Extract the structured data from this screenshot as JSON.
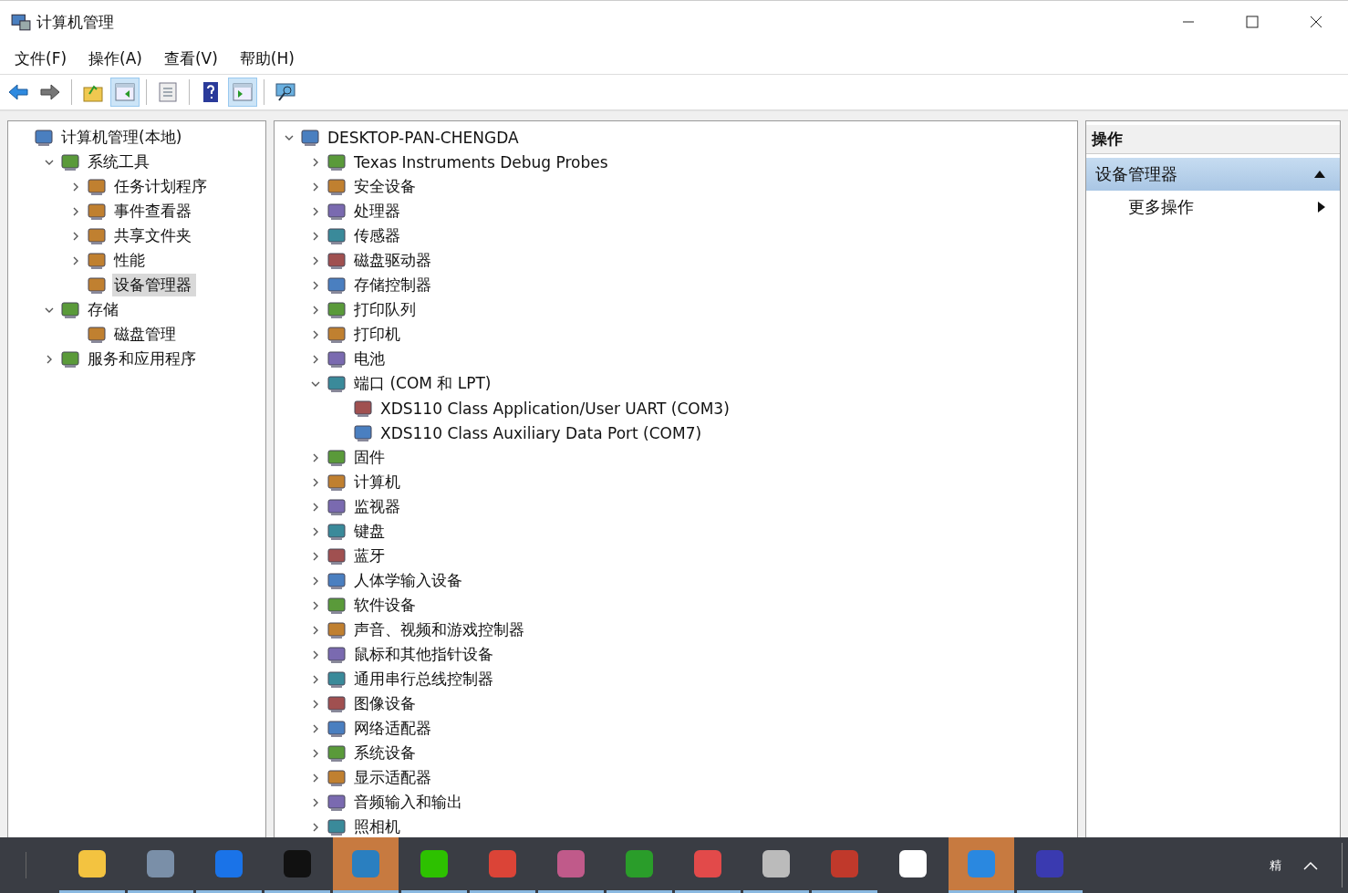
{
  "window": {
    "title": "计算机管理"
  },
  "menu": [
    "文件(F)",
    "操作(A)",
    "查看(V)",
    "帮助(H)"
  ],
  "toolbar": [
    {
      "kind": "back",
      "pressed": false
    },
    {
      "kind": "forward",
      "pressed": false
    },
    {
      "kind": "sep"
    },
    {
      "kind": "up",
      "pressed": false
    },
    {
      "kind": "pane-left",
      "pressed": true
    },
    {
      "kind": "sep"
    },
    {
      "kind": "properties",
      "pressed": false
    },
    {
      "kind": "sep"
    },
    {
      "kind": "help",
      "pressed": false
    },
    {
      "kind": "pane-right",
      "pressed": true
    },
    {
      "kind": "sep"
    },
    {
      "kind": "monitor",
      "pressed": false
    }
  ],
  "nav_tree": [
    {
      "label": "计算机管理(本地)",
      "selected": false,
      "children": [
        {
          "label": "系统工具",
          "expanded": true,
          "selected": false,
          "children": [
            {
              "label": "任务计划程序",
              "expanded": false,
              "selected": false
            },
            {
              "label": "事件查看器",
              "expanded": false,
              "selected": false
            },
            {
              "label": "共享文件夹",
              "expanded": false,
              "selected": false
            },
            {
              "label": "性能",
              "expanded": false,
              "selected": false
            },
            {
              "label": "设备管理器",
              "selected": true
            }
          ]
        },
        {
          "label": "存储",
          "expanded": true,
          "selected": false,
          "children": [
            {
              "label": "磁盘管理",
              "selected": false
            }
          ]
        },
        {
          "label": "服务和应用程序",
          "expanded": false,
          "selected": false
        }
      ]
    }
  ],
  "device_tree": [
    {
      "label": "DESKTOP-PAN-CHENGDA",
      "expanded": true,
      "children": [
        {
          "label": "Texas Instruments Debug Probes",
          "expanded": false
        },
        {
          "label": "安全设备",
          "expanded": false
        },
        {
          "label": "处理器",
          "expanded": false
        },
        {
          "label": "传感器",
          "expanded": false
        },
        {
          "label": "磁盘驱动器",
          "expanded": false
        },
        {
          "label": "存储控制器",
          "expanded": false
        },
        {
          "label": "打印队列",
          "expanded": false
        },
        {
          "label": "打印机",
          "expanded": false
        },
        {
          "label": "电池",
          "expanded": false
        },
        {
          "label": "端口 (COM 和 LPT)",
          "expanded": true,
          "children": [
            {
              "label": "XDS110 Class Application/User UART (COM3)"
            },
            {
              "label": "XDS110 Class Auxiliary Data Port (COM7)"
            }
          ]
        },
        {
          "label": "固件",
          "expanded": false
        },
        {
          "label": "计算机",
          "expanded": false
        },
        {
          "label": "监视器",
          "expanded": false
        },
        {
          "label": "键盘",
          "expanded": false
        },
        {
          "label": "蓝牙",
          "expanded": false
        },
        {
          "label": "人体学输入设备",
          "expanded": false
        },
        {
          "label": "软件设备",
          "expanded": false
        },
        {
          "label": "声音、视频和游戏控制器",
          "expanded": false
        },
        {
          "label": "鼠标和其他指针设备",
          "expanded": false
        },
        {
          "label": "通用串行总线控制器",
          "expanded": false
        },
        {
          "label": "图像设备",
          "expanded": false
        },
        {
          "label": "网络适配器",
          "expanded": false
        },
        {
          "label": "系统设备",
          "expanded": false
        },
        {
          "label": "显示适配器",
          "expanded": false
        },
        {
          "label": "音频输入和输出",
          "expanded": false
        },
        {
          "label": "照相机",
          "expanded": false
        }
      ]
    }
  ],
  "actions": {
    "title": "操作",
    "section": {
      "label": "设备管理器",
      "expanded": true
    },
    "items": [
      {
        "label": "更多操作"
      }
    ]
  },
  "taskbar": {
    "apps": [
      {
        "color": "#f3c340",
        "selected": false,
        "running": true
      },
      {
        "color": "#7a8fa8",
        "selected": false,
        "running": true
      },
      {
        "color": "#1a73e8",
        "selected": false,
        "running": true
      },
      {
        "color": "#111111",
        "selected": false,
        "running": true
      },
      {
        "color": "#2a7fc0",
        "selected": true,
        "running": true
      },
      {
        "color": "#2dc100",
        "selected": false,
        "running": true
      },
      {
        "color": "#db4437",
        "selected": false,
        "running": true
      },
      {
        "color": "#c05a8a",
        "selected": false,
        "running": true
      },
      {
        "color": "#2a9d2a",
        "selected": false,
        "running": true
      },
      {
        "color": "#e24a4a",
        "selected": false,
        "running": true
      },
      {
        "color": "#bbbbbb",
        "selected": false,
        "running": true
      },
      {
        "color": "#c0392b",
        "selected": false,
        "running": true
      },
      {
        "color": "#ffffff",
        "selected": false,
        "running": false
      },
      {
        "color": "#2a88e0",
        "selected": true,
        "running": true
      },
      {
        "color": "#3a3ab0",
        "selected": false,
        "running": true
      }
    ],
    "ime": "精"
  }
}
